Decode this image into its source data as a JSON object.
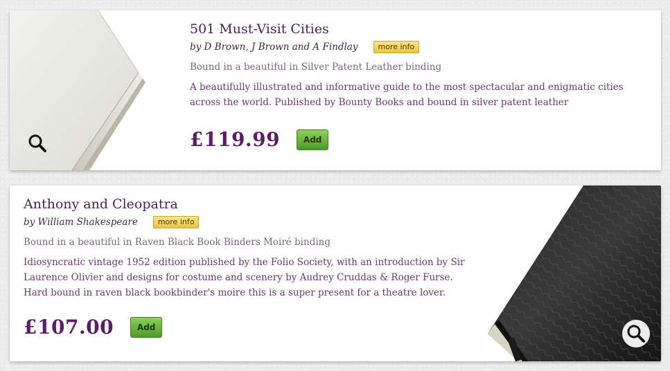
{
  "products": [
    {
      "title": "501 Must-Visit Cities",
      "author": "by D Brown, J Brown and A Findlay",
      "more_info_label": "more info",
      "binding": "Bound in a beautiful in Silver Patent Leather binding",
      "description": "A beautifully illustrated and informative guide to the most spectacular and enigmatic cities across the world. Published by Bounty Books and bound in silver patent leather",
      "price": "£119.99",
      "add_label": "Add",
      "image_icon": "book-cover-silver",
      "zoom_icon": "magnifier-icon"
    },
    {
      "title": "Anthony and Cleopatra",
      "author": "by William Shakespeare",
      "more_info_label": "more info",
      "binding": "Bound in a beautiful in Raven Black Book Binders Moiré binding",
      "description": "Idiosyncratic vintage 1952 edition published by the Folio Society, with an introduction by Sir Laurence Olivier and designs for costume and scenery by Audrey Cruddas & Roger Furse. Hard bound in raven black bookbinder's moire this is a super present for a theatre lover.",
      "price": "£107.00",
      "add_label": "Add",
      "image_icon": "book-cover-black-moire",
      "zoom_icon": "magnifier-icon"
    }
  ],
  "colors": {
    "accent_purple": "#5b1f63",
    "add_button_green": "#6fb83f",
    "more_info_yellow": "#f2d561"
  }
}
